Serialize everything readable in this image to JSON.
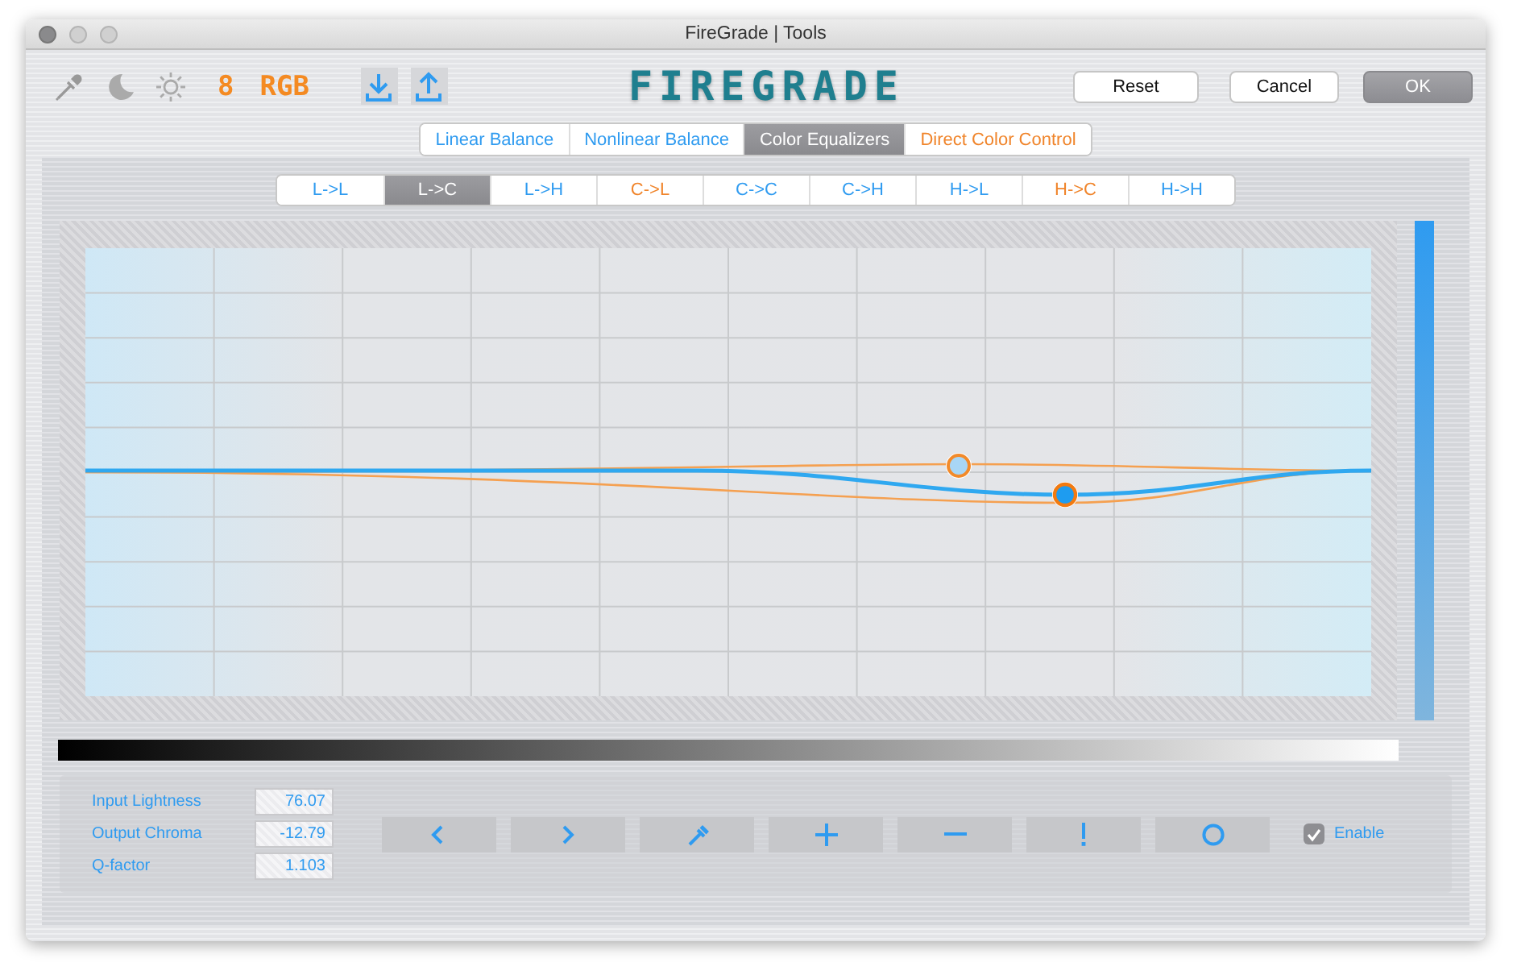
{
  "window": {
    "title": "FireGrade | Tools"
  },
  "toolbar": {
    "bit_depth": "8",
    "color_space": "RGB",
    "logo": "FIREGRADE",
    "buttons": [
      {
        "label": "Reset",
        "kind": "plain"
      },
      {
        "label": "Cancel",
        "kind": "plain"
      },
      {
        "label": "OK",
        "kind": "default"
      }
    ]
  },
  "tabs": [
    {
      "label": "Linear Balance",
      "selected": false,
      "color": "#2f9bf0"
    },
    {
      "label": "Nonlinear Balance",
      "selected": false,
      "color": "#2f9bf0"
    },
    {
      "label": "Color Equalizers",
      "selected": true
    },
    {
      "label": "Direct Color Control",
      "selected": false,
      "color": "#f0842a"
    }
  ],
  "subtabs": [
    {
      "label": "L->L",
      "selected": false,
      "color": "#2f9bf0"
    },
    {
      "label": "L->C",
      "selected": true
    },
    {
      "label": "L->H",
      "selected": false,
      "color": "#2f9bf0"
    },
    {
      "label": "C->L",
      "selected": false,
      "color": "#f0842a"
    },
    {
      "label": "C->C",
      "selected": false,
      "color": "#2f9bf0"
    },
    {
      "label": "C->H",
      "selected": false,
      "color": "#2f9bf0"
    },
    {
      "label": "H->L",
      "selected": false,
      "color": "#2f9bf0"
    },
    {
      "label": "H->C",
      "selected": false,
      "color": "#f0842a"
    },
    {
      "label": "H->H",
      "selected": false,
      "color": "#2f9bf0"
    }
  ],
  "parameters": [
    {
      "label": "Input Lightness",
      "value": "76.07"
    },
    {
      "label": "Output Chroma",
      "value": "-12.79"
    },
    {
      "label": "Q-factor",
      "value": "1.103"
    }
  ],
  "enable": {
    "label": "Enable",
    "checked": true
  }
}
